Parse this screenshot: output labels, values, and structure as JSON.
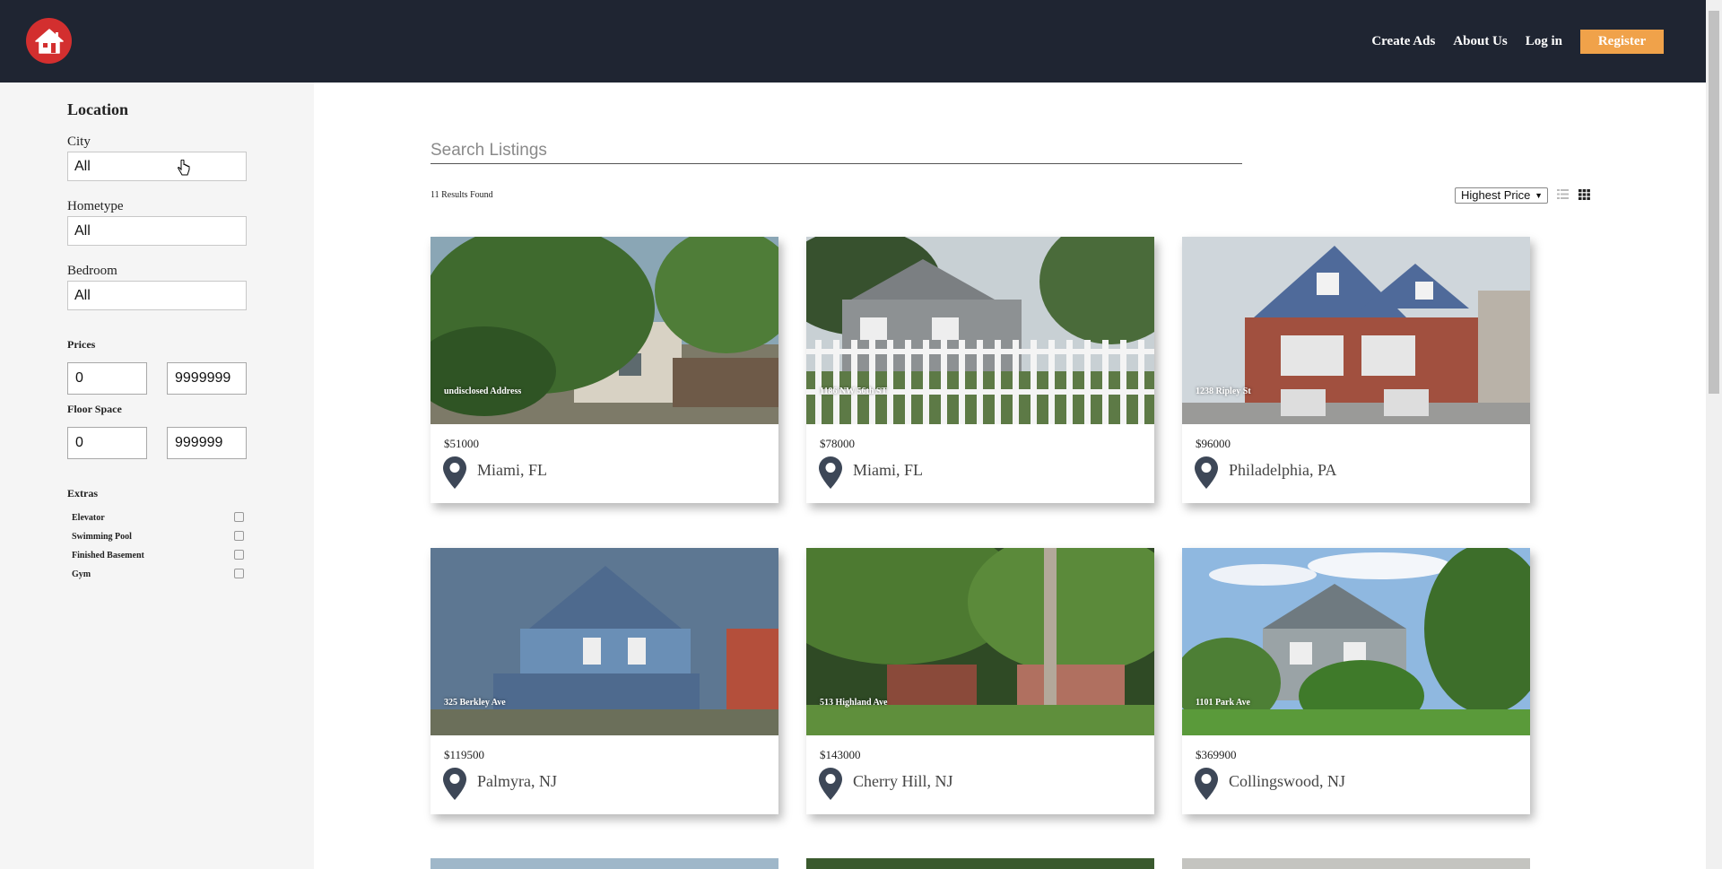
{
  "header": {
    "logo_icon": "home-icon",
    "brand_color": "#d32f2f",
    "nav": {
      "create_ads": "Create Ads",
      "about_us": "About Us",
      "log_in": "Log in",
      "register": "Register"
    },
    "accent": "#f0a24a"
  },
  "sidebar": {
    "title": "Location",
    "city": {
      "label": "City",
      "value": "All"
    },
    "hometype": {
      "label": "Hometype",
      "value": "All"
    },
    "bedroom": {
      "label": "Bedroom",
      "value": "All"
    },
    "prices": {
      "label": "Prices",
      "min": "0",
      "max": "9999999"
    },
    "floor_space": {
      "label": "Floor Space",
      "min": "0",
      "max": "999999"
    },
    "extras": {
      "label": "Extras",
      "items": [
        {
          "label": "Elevator",
          "checked": false
        },
        {
          "label": "Swimming Pool",
          "checked": false
        },
        {
          "label": "Finished Basement",
          "checked": false
        },
        {
          "label": "Gym",
          "checked": false
        }
      ]
    }
  },
  "main": {
    "search_placeholder": "Search Listings",
    "results_text": "11 Results Found",
    "sort_value": "Highest Price",
    "listings": [
      {
        "address": "undisclosed Address",
        "price": "$51000",
        "city": "Miami, FL"
      },
      {
        "address": "1186 NW 56th ST",
        "price": "$78000",
        "city": "Miami, FL"
      },
      {
        "address": "1238 Ripley St",
        "price": "$96000",
        "city": "Philadelphia, PA"
      },
      {
        "address": "325 Berkley Ave",
        "price": "$119500",
        "city": "Palmyra, NJ"
      },
      {
        "address": "513 Highland Ave",
        "price": "$143000",
        "city": "Cherry Hill, NJ"
      },
      {
        "address": "1101 Park Ave",
        "price": "$369900",
        "city": "Collingswood, NJ"
      }
    ]
  }
}
